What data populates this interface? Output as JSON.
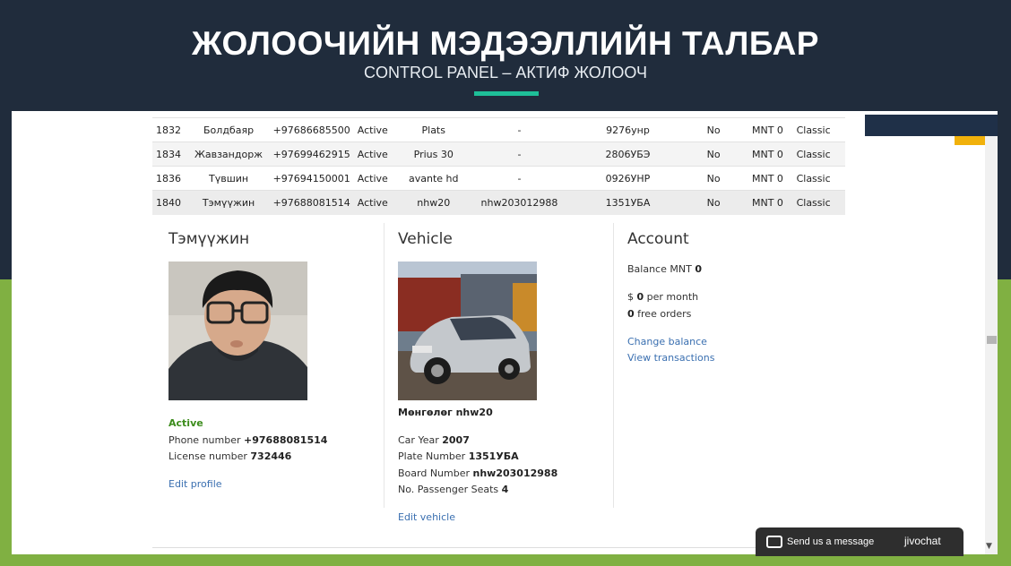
{
  "slide": {
    "title": "ЖОЛООЧИЙН МЭДЭЭЛЛИЙН ТАЛБАР",
    "subtitle": "CONTROL PANEL – АКТИФ ЖОЛООЧ",
    "accent_color": "#1ebf98",
    "background_top": "#202c3c",
    "background_bottom": "#80b042"
  },
  "drivers": [
    {
      "id": "1832",
      "name": "Болдбаяр",
      "phone": "+97686685500",
      "status": "Active",
      "model": "Plats",
      "board": "-",
      "plate": "9276унр",
      "flag": "No",
      "balance": "MNT 0",
      "plan": "Classic"
    },
    {
      "id": "1834",
      "name": "Жавзандорж",
      "phone": "+97699462915",
      "status": "Active",
      "model": "Prius 30",
      "board": "-",
      "plate": "2806УБЭ",
      "flag": "No",
      "balance": "MNT 0",
      "plan": "Classic"
    },
    {
      "id": "1836",
      "name": "Түвшин",
      "phone": "+97694150001",
      "status": "Active",
      "model": "avante hd",
      "board": "-",
      "plate": "0926УНР",
      "flag": "No",
      "balance": "MNT 0",
      "plan": "Classic"
    },
    {
      "id": "1840",
      "name": "Тэмүүжин",
      "phone": "+97688081514",
      "status": "Active",
      "model": "nhw20",
      "board": "nhw203012988",
      "plate": "1351УБА",
      "flag": "No",
      "balance": "MNT 0",
      "plan": "Classic"
    }
  ],
  "driver": {
    "heading": "Тэмүүжин",
    "status": "Active",
    "phone_label": "Phone number",
    "phone": "+97688081514",
    "license_label": "License number",
    "license": "732446",
    "edit_link": "Edit profile"
  },
  "vehicle": {
    "heading": "Vehicle",
    "title": "Мөнгөлөг nhw20",
    "year_label": "Car Year",
    "year": "2007",
    "plate_label": "Plate Number",
    "plate": "1351УБА",
    "board_label": "Board Number",
    "board": "nhw203012988",
    "seats_label": "No. Passenger Seats",
    "seats": "4",
    "edit_link": "Edit vehicle"
  },
  "account": {
    "heading": "Account",
    "balance_label": "Balance MNT",
    "balance": "0",
    "per_month_prefix": "$",
    "per_month_value": "0",
    "per_month_suffix": "per month",
    "free_orders_value": "0",
    "free_orders_label": "free orders",
    "change_balance_link": "Change balance",
    "view_transactions_link": "View transactions"
  },
  "chat": {
    "label": "Send us a message",
    "brand": "jivochat"
  }
}
